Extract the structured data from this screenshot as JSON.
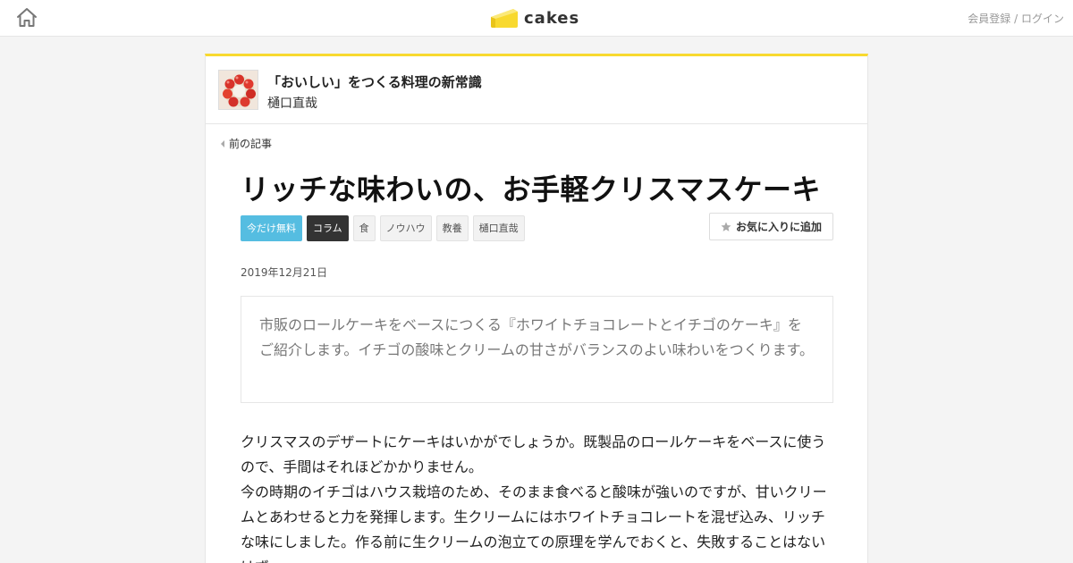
{
  "header": {
    "logo_text": "cakes",
    "auth": {
      "register": "会員登録",
      "separator": " / ",
      "login": "ログイン"
    }
  },
  "series": {
    "title": "「おいしい」をつくる料理の新常識",
    "author": "樋口直哉"
  },
  "nav": {
    "prev_label": "前の記事"
  },
  "article": {
    "title": "リッチな味わいの、お手軽クリスマスケーキ",
    "tags": [
      "今だけ無料",
      "コラム",
      "食",
      "ノウハウ",
      "教養",
      "樋口直哉"
    ],
    "favorite_label": "お気に入りに追加",
    "date": "2019年12月21日",
    "lead": "市販のロールケーキをベースにつくる『ホワイトチョコレートとイチゴのケーキ』をご紹介します。イチゴの酸味とクリームの甘さがバランスのよい味わいをつくります。",
    "paragraphs": [
      "クリスマスのデザートにケーキはいかがでしょうか。既製品のロールケーキをベースに使うので、手間はそれほどかかりません。",
      "今の時期のイチゴはハウス栽培のため、そのまま食べると酸味が強いのですが、甘いクリームとあわせると力を発揮します。生クリームにはホワイトチョコレートを混ぜ込み、リッチな味にしました。作る前に生クリームの泡立ての原理を学んでおくと、失敗することはないはず。"
    ]
  },
  "colors": {
    "accent_yellow": "#f8d92f",
    "free_tag": "#55bde1",
    "column_tag": "#333333"
  },
  "icons": {
    "home": "home-icon",
    "prev": "chevron-left-icon",
    "favorite": "star-icon"
  }
}
